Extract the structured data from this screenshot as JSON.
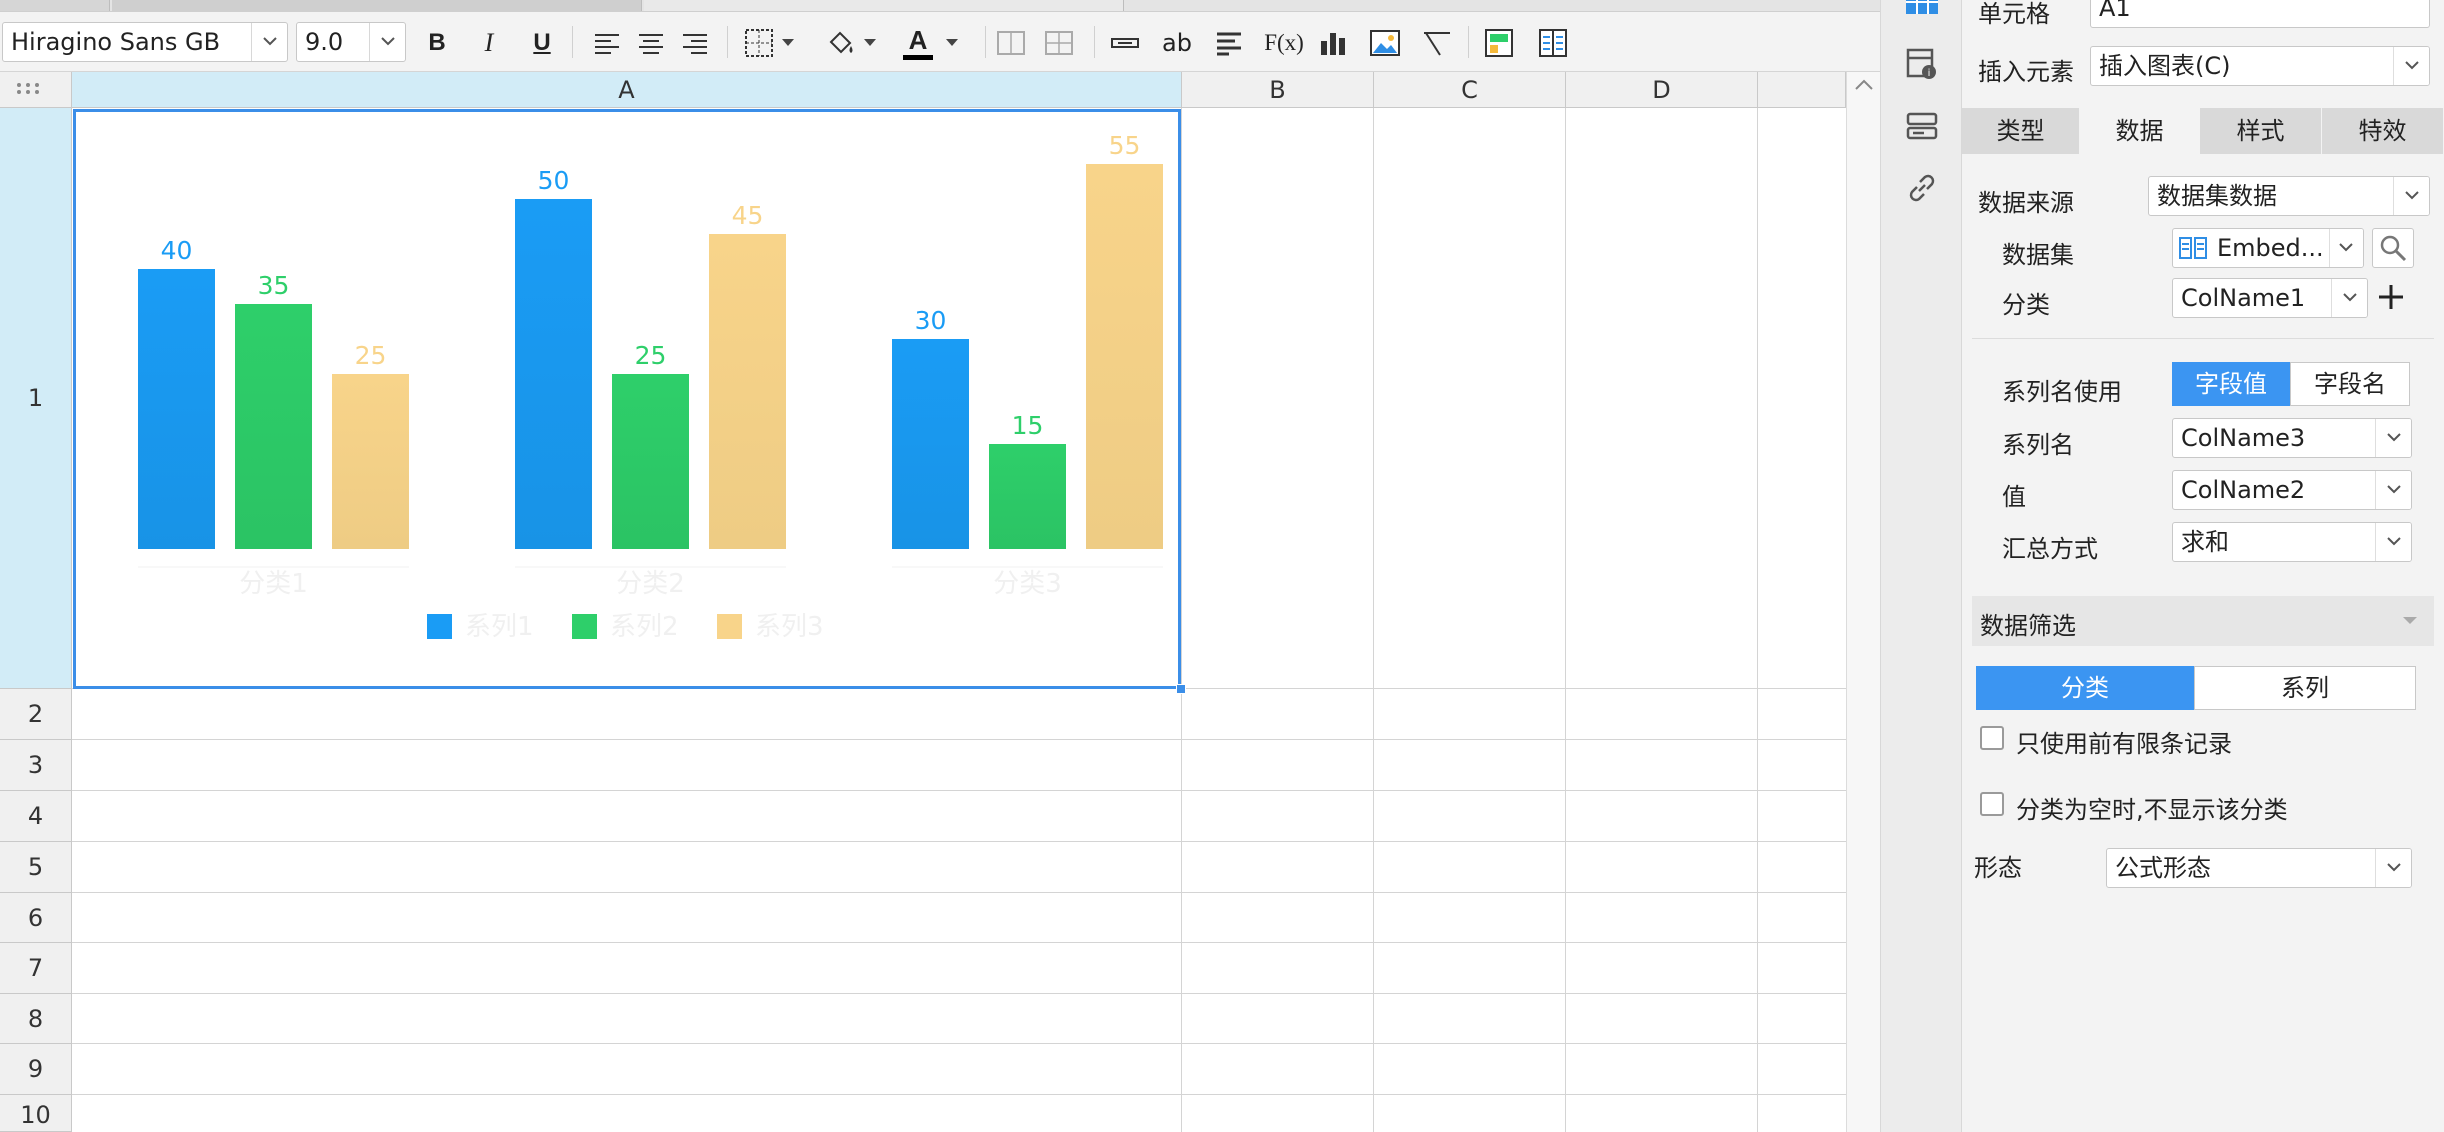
{
  "toolbar": {
    "font_family": "Hiragino Sans GB",
    "font_size": "9.0",
    "bold_label": "B",
    "italic_label": "I",
    "underline_label": "U",
    "font_color_label": "A",
    "text_label": "ab",
    "formula_label": "F(x)"
  },
  "grid": {
    "columns": [
      "A",
      "B",
      "C",
      "D"
    ],
    "rows": [
      "1",
      "2",
      "3",
      "4",
      "5",
      "6",
      "7",
      "8",
      "9",
      "10"
    ]
  },
  "chart_data": {
    "type": "bar",
    "categories": [
      "分类1",
      "分类2",
      "分类3"
    ],
    "series": [
      {
        "name": "系列1",
        "values": [
          40,
          50,
          30
        ],
        "color": "#1a9cf5"
      },
      {
        "name": "系列2",
        "values": [
          35,
          25,
          15
        ],
        "color": "#2ecf6a"
      },
      {
        "name": "系列3",
        "values": [
          25,
          45,
          55
        ],
        "color": "#f8d48a"
      }
    ],
    "ylim": [
      0,
      60
    ],
    "grid": false,
    "legend": "bottom",
    "data_labels": true
  },
  "panel": {
    "cell_label": "单元格",
    "cell_value": "A1",
    "insert_label": "插入元素",
    "insert_value": "插入图表(C)",
    "tabs": [
      "类型",
      "数据",
      "样式",
      "特效"
    ],
    "active_tab": "数据",
    "data_source_label": "数据来源",
    "data_source_value": "数据集数据",
    "dataset_label": "数据集",
    "dataset_value": "Embed...",
    "category_label": "分类",
    "category_value": "ColName1",
    "series_name_use_label": "系列名使用",
    "series_name_use_options": [
      "字段值",
      "字段名"
    ],
    "series_name_label": "系列名",
    "series_name_value": "ColName3",
    "value_label": "值",
    "value_value": "ColName2",
    "summary_label": "汇总方式",
    "summary_value": "求和",
    "filter_label": "数据筛选",
    "filter_tabs": [
      "分类",
      "系列"
    ],
    "check_top_records": "只使用前有限条记录",
    "check_empty_category": "分类为空时,不显示该分类",
    "form_label": "形态",
    "form_value": "公式形态"
  },
  "icons": {
    "strip": [
      "grid-icon",
      "cell-attr-icon",
      "widget-icon",
      "link-icon"
    ]
  }
}
